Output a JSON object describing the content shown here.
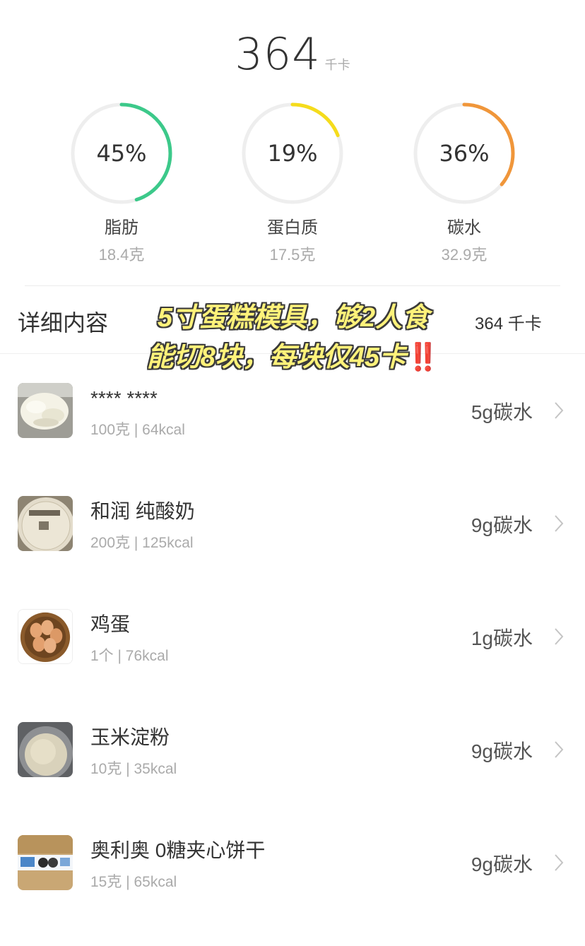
{
  "summary": {
    "total_value": "364",
    "total_unit": "千卡"
  },
  "macros": [
    {
      "percent_label": "45%",
      "percent": 45,
      "name": "脂肪",
      "grams": "18.4克",
      "color": "#3cc98a"
    },
    {
      "percent_label": "19%",
      "percent": 19,
      "name": "蛋白质",
      "grams": "17.5克",
      "color": "#f5dc1c"
    },
    {
      "percent_label": "36%",
      "percent": 36,
      "name": "碳水",
      "grams": "32.9克",
      "color": "#f0963a"
    }
  ],
  "details": {
    "title": "详细内容",
    "total": "364 千卡"
  },
  "overlay": {
    "line1": "5寸蛋糕模具，够2人食",
    "line2": "能切8块，每块仅45卡",
    "emoji": "‼️"
  },
  "items": [
    {
      "name": "**** ****",
      "sub": "100克 | 64kcal",
      "carb": "5g碳水",
      "icon": "cream-cheese-photo"
    },
    {
      "name": "和润 纯酸奶",
      "sub": "200克 | 125kcal",
      "carb": "9g碳水",
      "icon": "yogurt-photo"
    },
    {
      "name": "鸡蛋",
      "sub": "1个 | 76kcal",
      "carb": "1g碳水",
      "icon": "eggs-photo"
    },
    {
      "name": "玉米淀粉",
      "sub": "10克 | 35kcal",
      "carb": "9g碳水",
      "icon": "corn-starch-photo"
    },
    {
      "name": "奥利奥 0糖夹心饼干",
      "sub": "15克 | 65kcal",
      "carb": "9g碳水",
      "icon": "oreo-photo"
    }
  ],
  "colors": {
    "ring_track": "#eeeeee",
    "text_primary": "#333333",
    "text_secondary": "#aaaaaa"
  }
}
